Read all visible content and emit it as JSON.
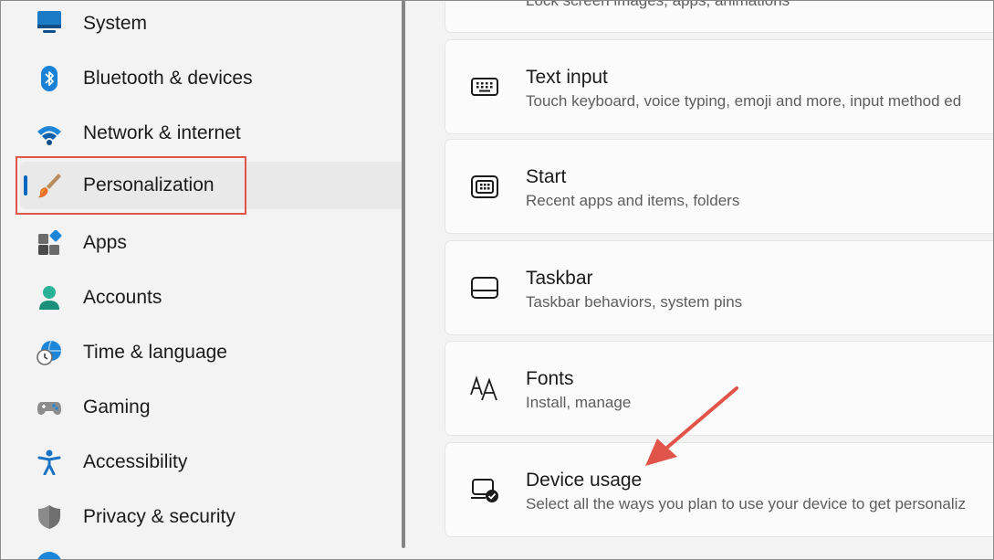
{
  "sidebar": {
    "items": [
      {
        "label": "System",
        "icon": "monitor-icon"
      },
      {
        "label": "Bluetooth & devices",
        "icon": "bluetooth-icon"
      },
      {
        "label": "Network & internet",
        "icon": "wifi-icon"
      },
      {
        "label": "Personalization",
        "icon": "paintbrush-icon",
        "selected": true
      },
      {
        "label": "Apps",
        "icon": "apps-icon"
      },
      {
        "label": "Accounts",
        "icon": "person-icon"
      },
      {
        "label": "Time & language",
        "icon": "globe-clock-icon"
      },
      {
        "label": "Gaming",
        "icon": "gamepad-icon"
      },
      {
        "label": "Accessibility",
        "icon": "accessibility-icon"
      },
      {
        "label": "Privacy & security",
        "icon": "shield-icon"
      }
    ]
  },
  "cards": [
    {
      "title": "",
      "description": "Lock screen images, apps, animations",
      "icon": ""
    },
    {
      "title": "Text input",
      "description": "Touch keyboard, voice typing, emoji and more, input method ed",
      "icon": "keyboard-icon"
    },
    {
      "title": "Start",
      "description": "Recent apps and items, folders",
      "icon": "start-icon"
    },
    {
      "title": "Taskbar",
      "description": "Taskbar behaviors, system pins",
      "icon": "taskbar-icon"
    },
    {
      "title": "Fonts",
      "description": "Install, manage",
      "icon": "fonts-icon"
    },
    {
      "title": "Device usage",
      "description": "Select all the ways you plan to use your device to get personaliz",
      "icon": "device-usage-icon"
    }
  ],
  "colors": {
    "accent": "#0067c0",
    "annotation": "#e0544a"
  }
}
